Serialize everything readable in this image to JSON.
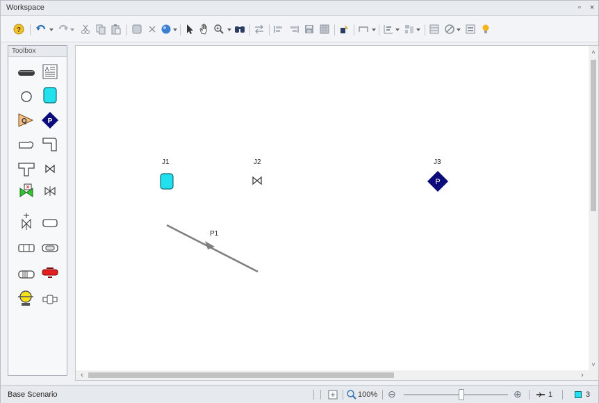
{
  "window": {
    "title": "Workspace",
    "restore_glyph": "▫",
    "close_glyph": "×"
  },
  "toolbar": {
    "icons": [
      "help-icon",
      "undo-icon",
      "redo-icon",
      "cut-icon",
      "copy-icon",
      "paste-icon",
      "select-box-icon",
      "delete-icon",
      "color-icon",
      "pointer-icon",
      "pan-hand-icon",
      "zoom-icon",
      "find-icon",
      "reverse-icon",
      "align-left-icon",
      "align-right-icon",
      "save-icon",
      "grid-icon",
      "annotation-icon",
      "pipe-draw-icon",
      "layer-icon",
      "layout-icon",
      "table-icon",
      "hide-icon",
      "properties-icon",
      "bulb-icon"
    ]
  },
  "toolbox": {
    "title": "Toolbox",
    "tools": [
      "pipe-tool",
      "annotation-tool",
      "branch-tool",
      "reservoir-tool",
      "assigned-flow-tool",
      "assigned-pressure-tool",
      "bend-tool",
      "elbow-tool",
      "tee-tool",
      "valve-tool",
      "control-valve-tool",
      "check-valve-tool",
      "relief-valve-tool",
      "dead-end-tool",
      "area-change-tool",
      "spray-tool",
      "heat-exchanger-tool",
      "pump-tool",
      "volume-balance-tool",
      "general-component-tool"
    ]
  },
  "canvas": {
    "junctions": [
      {
        "id": "J1",
        "label": "J1",
        "type": "reservoir",
        "color": "#22e1ee"
      },
      {
        "id": "J2",
        "label": "J2",
        "type": "valve",
        "color": "#333333"
      },
      {
        "id": "J3",
        "label": "J3",
        "type": "assigned-pressure",
        "color": "#0b0b7a",
        "glyph": "P"
      }
    ],
    "pipes": [
      {
        "id": "P1",
        "label": "P1",
        "color": "#7f7f7f"
      }
    ]
  },
  "scroll": {
    "up": "˄",
    "down": "˅",
    "left": "‹",
    "right": "›"
  },
  "status": {
    "scenario": "Base Scenario",
    "zoom": "100%",
    "zoom_level": 0.55,
    "zoom_out": "⊖",
    "zoom_in": "⊕",
    "pipe_count": "1",
    "junction_count": "3",
    "colors": {
      "junction_badge": "#22e1ee"
    }
  }
}
